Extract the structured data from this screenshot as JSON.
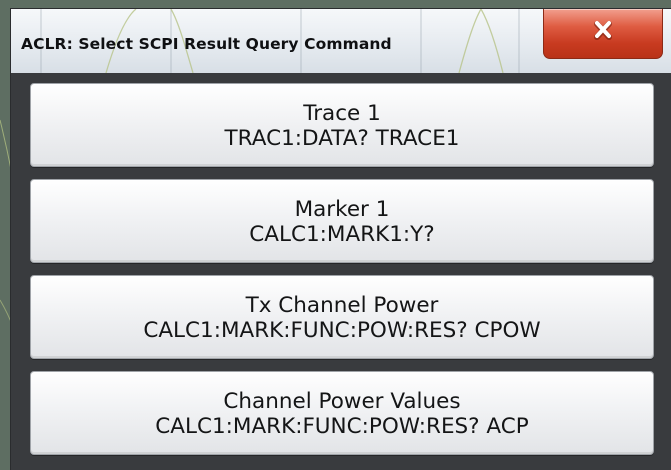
{
  "dialog": {
    "title": "ACLR: Select SCPI Result Query Command",
    "close_icon": "close-x-icon",
    "accent_close": "#d24a2e"
  },
  "buttons": [
    {
      "label": "Trace 1",
      "command": "TRAC1:DATA? TRACE1"
    },
    {
      "label": "Marker 1",
      "command": "CALC1:MARK1:Y?"
    },
    {
      "label": "Tx Channel Power",
      "command": "CALC1:MARK:FUNC:POW:RES? CPOW"
    },
    {
      "label": "Channel Power Values",
      "command": "CALC1:MARK:FUNC:POW:RES? ACP"
    }
  ]
}
